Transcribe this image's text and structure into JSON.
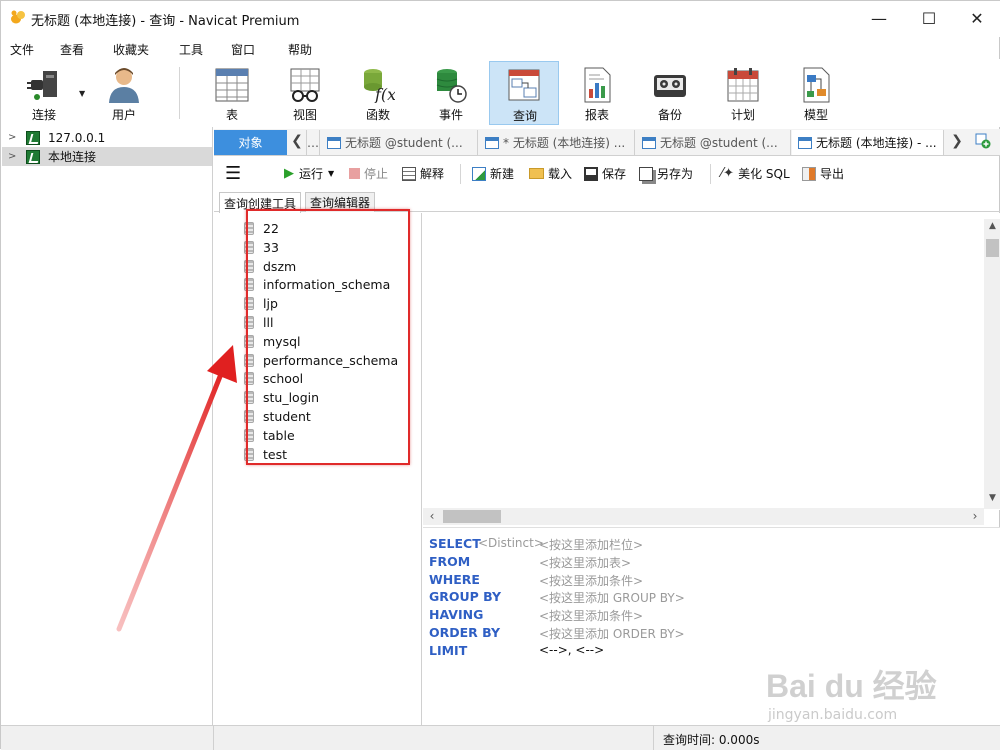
{
  "window": {
    "title": "无标题 (本地连接) - 查询 - Navicat Premium"
  },
  "menu": [
    "文件",
    "查看",
    "收藏夹",
    "工具",
    "窗口",
    "帮助"
  ],
  "toolbar": {
    "connect": "连接",
    "user": "用户",
    "table": "表",
    "view": "视图",
    "function": "函数",
    "event": "事件",
    "query": "查询",
    "report": "报表",
    "backup": "备份",
    "schedule": "计划",
    "model": "模型"
  },
  "tree": [
    {
      "label": "127.0.0.1"
    },
    {
      "label": "本地连接"
    }
  ],
  "tabs": {
    "object": "对象",
    "docs": [
      "无标题 @student (...",
      "* 无标题 (本地连接) ...",
      "无标题 @student (...",
      "无标题 (本地连接) - ..."
    ]
  },
  "query_toolbar": {
    "run": "运行",
    "stop": "停止",
    "explain": "解释",
    "new": "新建",
    "load": "载入",
    "save": "保存",
    "save_as": "另存为",
    "beautify": "美化 SQL",
    "export": "导出"
  },
  "subtabs": [
    "查询创建工具",
    "查询编辑器"
  ],
  "databases": [
    "22",
    "33",
    "dszm",
    "information_schema",
    "ljp",
    "lll",
    "mysql",
    "performance_schema",
    "school",
    "stu_login",
    "student",
    "table",
    "test"
  ],
  "sql": {
    "select_kw": "SELECT",
    "distinct": "<Distinct>",
    "select_ph": "<按这里添加栏位>",
    "from_kw": "FROM",
    "from_ph": "<按这里添加表>",
    "where_kw": "WHERE",
    "where_ph": "<按这里添加条件>",
    "groupby_kw": "GROUP BY",
    "groupby_ph": "<按这里添加 GROUP BY>",
    "having_kw": "HAVING",
    "having_ph": "<按这里添加条件>",
    "orderby_kw": "ORDER BY",
    "orderby_ph": "<按这里添加 ORDER BY>",
    "limit_kw": "LIMIT",
    "limit_val": "<-->, <-->"
  },
  "status": {
    "query_time": "查询时间: 0.000s"
  },
  "watermark": {
    "main": "Bai du 经验",
    "sub": "jingyan.baidu.com"
  },
  "colors": {
    "accent": "#3d8fde",
    "active_tool": "#cce4f7",
    "keyword": "#2f5fc4",
    "highlight": "#e02a2a"
  }
}
